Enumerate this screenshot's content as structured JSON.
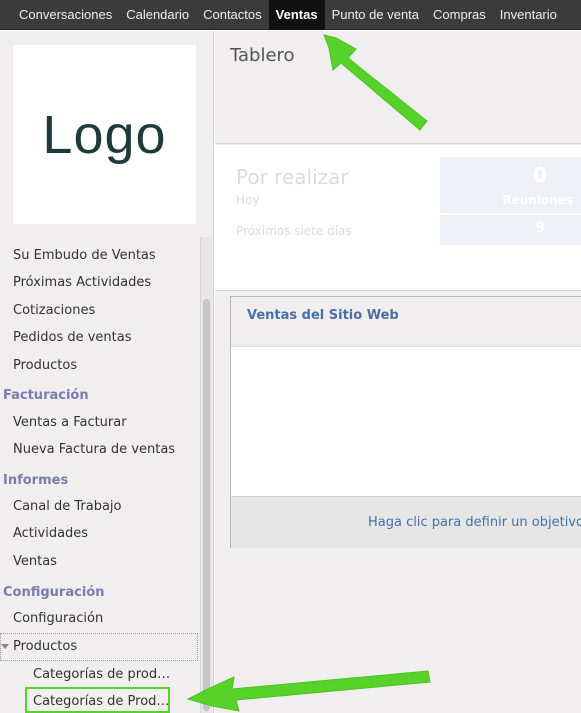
{
  "topnav": {
    "items": [
      "Conversaciones",
      "Calendario",
      "Contactos",
      "Ventas",
      "Punto de venta",
      "Compras",
      "Inventario"
    ],
    "active": "Ventas"
  },
  "logo": {
    "text": "Logo"
  },
  "sidebar": {
    "items_top": [
      "Su Embudo de Ventas",
      "Próximas Actividades",
      "Cotizaciones",
      "Pedidos de ventas",
      "Productos"
    ],
    "section_facturacion": "Facturación",
    "items_facturacion": [
      "Ventas a Facturar",
      "Nueva Factura de ventas"
    ],
    "section_informes": "Informes",
    "items_informes": [
      "Canal de Trabajo",
      "Actividades",
      "Ventas"
    ],
    "section_configuracion": "Configuración",
    "items_configuracion": [
      "Configuración",
      "Productos"
    ],
    "sub_productos": [
      "Categorías de prod…",
      "Categorías de Prod…"
    ]
  },
  "main": {
    "title": "Tablero",
    "todo": {
      "title": "Por realizar",
      "today_label": "Hoy",
      "week_label": "Próximos siete días",
      "meetings_count": "0",
      "meetings_label": "Reuniones",
      "week_count": "9"
    },
    "web": {
      "title": "Ventas del Sitio Web",
      "link": "Haga clic para definir un objetivo"
    }
  },
  "colors": {
    "nav_bg": "#3b3b3b",
    "section_header": "#7c7bad",
    "link": "#4870a7",
    "annotation": "#57d22a"
  }
}
